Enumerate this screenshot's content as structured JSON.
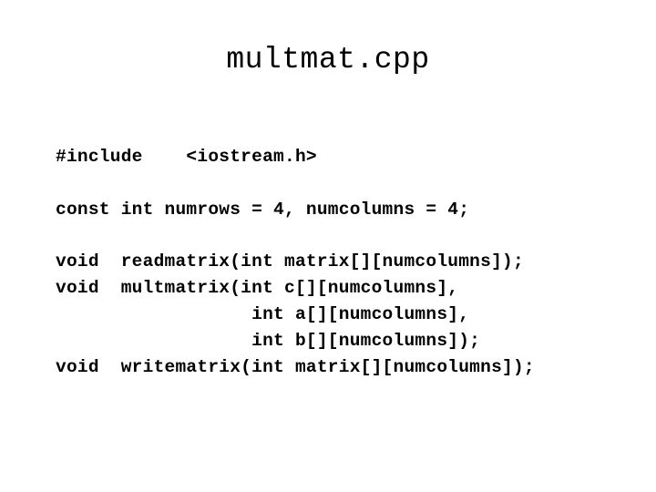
{
  "slide": {
    "title": "multmat.cpp",
    "code_lines": [
      {
        "text": "#include    <iostream.h>"
      },
      {
        "text": "const int numrows = 4, numcolumns = 4;"
      },
      {
        "text": "void  readmatrix(int matrix[][numcolumns]);"
      },
      {
        "text": "void  multmatrix(int c[][numcolumns],"
      },
      {
        "text": "                  int a[][numcolumns],"
      },
      {
        "text": "                  int b[][numcolumns]);"
      },
      {
        "text": "void  writematrix(int matrix[][numcolumns]);"
      }
    ]
  }
}
